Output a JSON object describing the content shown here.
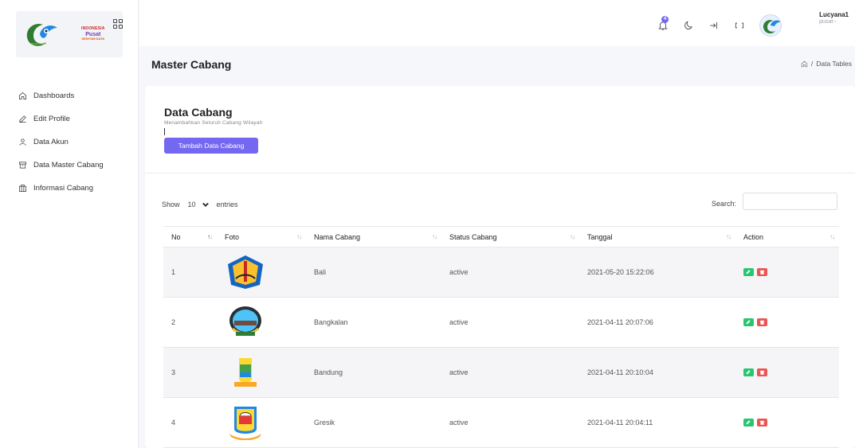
{
  "sidebar": {
    "logo": {
      "line1": "INDONESIA",
      "line2": "Pusat",
      "line3": "SENYUM DATA"
    },
    "items": [
      {
        "label": "Dashboards",
        "icon": "home-icon"
      },
      {
        "label": "Edit Profile",
        "icon": "edit-icon"
      },
      {
        "label": "Data Akun",
        "icon": "user-icon"
      },
      {
        "label": "Data Master Cabang",
        "icon": "archive-icon"
      },
      {
        "label": "Informasi Cabang",
        "icon": "columns-icon"
      }
    ]
  },
  "topbar": {
    "notification_count": "4",
    "user_name": "Lucyana1",
    "user_role": "pusat--"
  },
  "page": {
    "title": "Master Cabang",
    "breadcrumb": "Data Tables"
  },
  "card": {
    "title": "Data Cabang",
    "subtitle": "Menambahkan Seluruh Cabang Wilayah",
    "add_button": "Tambah Data Cabang"
  },
  "table_controls": {
    "show_label": "Show",
    "entries_value": "10",
    "entries_label": "entries",
    "search_label": "Search:"
  },
  "table": {
    "columns": [
      "No",
      "Foto",
      "Nama Cabang",
      "Status Cabang",
      "Tanggal",
      "Action"
    ],
    "rows": [
      {
        "no": "1",
        "nama": "Bali",
        "status": "active",
        "tanggal": "2021-05-20 15:22:06"
      },
      {
        "no": "2",
        "nama": "Bangkalan",
        "status": "active",
        "tanggal": "2021-04-11 20:07:06"
      },
      {
        "no": "3",
        "nama": "Bandung",
        "status": "active",
        "tanggal": "2021-04-11 20:10:04"
      },
      {
        "no": "4",
        "nama": "Gresik",
        "status": "active",
        "tanggal": "2021-04-11 20:04:11"
      }
    ]
  },
  "colors": {
    "primary": "#7467f0",
    "edit": "#28c76f",
    "delete": "#ea5455"
  }
}
